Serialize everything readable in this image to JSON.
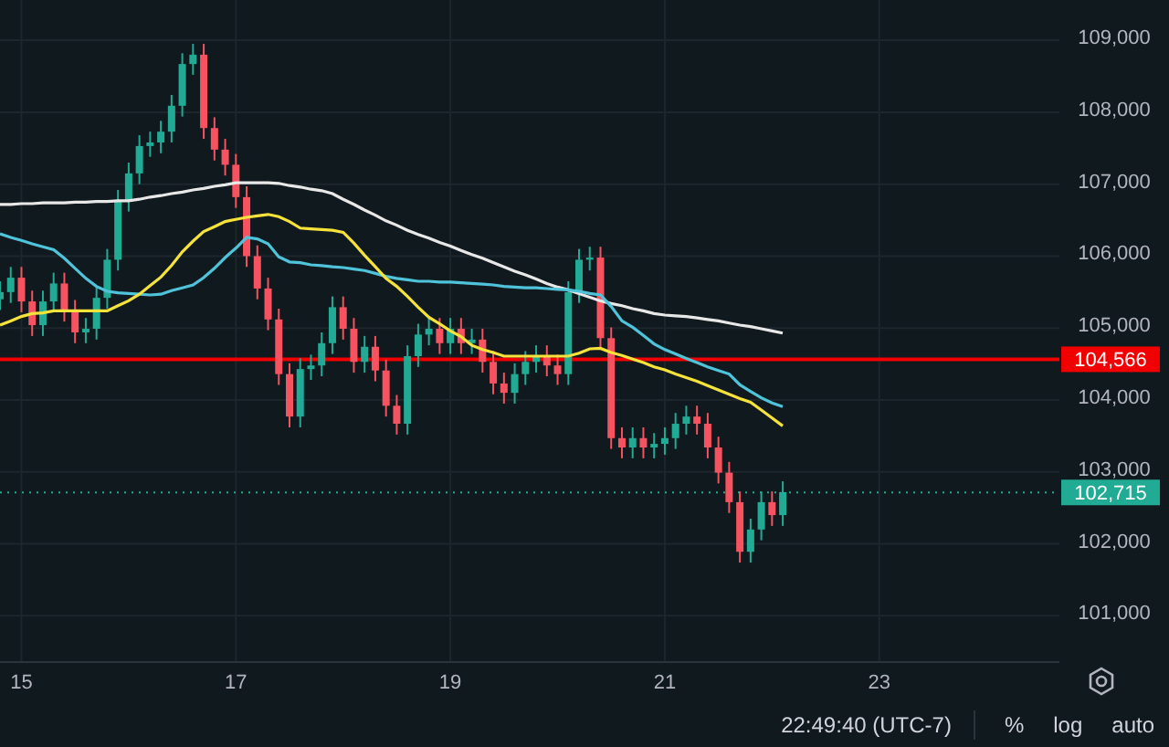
{
  "chart": {
    "chart_data": {
      "type": "candlestick",
      "x": [
        14.8,
        14.9,
        15.0,
        15.1,
        15.2,
        15.3,
        15.4,
        15.5,
        15.6,
        15.7,
        15.8,
        15.9,
        16.0,
        16.1,
        16.2,
        16.3,
        16.4,
        16.5,
        16.6,
        16.7,
        16.8,
        16.9,
        17.0,
        17.1,
        17.2,
        17.3,
        17.4,
        17.5,
        17.6,
        17.7,
        17.8,
        17.9,
        18.0,
        18.1,
        18.2,
        18.3,
        18.4,
        18.5,
        18.6,
        18.7,
        18.8,
        18.9,
        19.0,
        19.1,
        19.2,
        19.3,
        19.4,
        19.5,
        19.6,
        19.7,
        19.8,
        19.9,
        20.0,
        20.1,
        20.2,
        20.3,
        20.4,
        20.5,
        20.6,
        20.7,
        20.8,
        20.9,
        21.0,
        21.1,
        21.2,
        21.3,
        21.4,
        21.5,
        21.6,
        21.7,
        21.8,
        21.9,
        22.0,
        22.1
      ],
      "ohlc": [
        [
          105400,
          105650,
          105250,
          105500
        ],
        [
          105500,
          105850,
          105350,
          105700
        ],
        [
          105700,
          105850,
          105220,
          105370
        ],
        [
          105370,
          105520,
          104890,
          105040
        ],
        [
          105040,
          105520,
          104890,
          105370
        ],
        [
          105370,
          105770,
          105220,
          105620
        ],
        [
          105620,
          105770,
          105090,
          105240
        ],
        [
          105240,
          105390,
          104790,
          104940
        ],
        [
          104940,
          105140,
          104790,
          104990
        ],
        [
          104990,
          105570,
          104840,
          105420
        ],
        [
          105420,
          106100,
          105270,
          105950
        ],
        [
          105950,
          106920,
          105800,
          106770
        ],
        [
          106770,
          107300,
          106620,
          107150
        ],
        [
          107150,
          107680,
          107000,
          107530
        ],
        [
          107530,
          107730,
          107380,
          107580
        ],
        [
          107580,
          107880,
          107430,
          107730
        ],
        [
          107730,
          108240,
          107580,
          108090
        ],
        [
          108090,
          108820,
          107940,
          108670
        ],
        [
          108670,
          108950,
          108520,
          108800
        ],
        [
          108800,
          108950,
          107630,
          107780
        ],
        [
          107780,
          107930,
          107330,
          107480
        ],
        [
          107480,
          107630,
          107120,
          107270
        ],
        [
          107270,
          107420,
          106670,
          106820
        ],
        [
          106820,
          106970,
          105850,
          106000
        ],
        [
          106000,
          106150,
          105400,
          105550
        ],
        [
          105550,
          105700,
          104970,
          105120
        ],
        [
          105120,
          105270,
          104210,
          104360
        ],
        [
          104360,
          104510,
          103620,
          103770
        ],
        [
          103770,
          104580,
          103620,
          104430
        ],
        [
          104430,
          104630,
          104280,
          104480
        ],
        [
          104480,
          104940,
          104330,
          104790
        ],
        [
          104790,
          105440,
          104640,
          105290
        ],
        [
          105290,
          105440,
          104840,
          104990
        ],
        [
          104990,
          105140,
          104380,
          104530
        ],
        [
          104530,
          104890,
          104380,
          104740
        ],
        [
          104740,
          104890,
          104260,
          104410
        ],
        [
          104410,
          104560,
          103770,
          103920
        ],
        [
          103920,
          104070,
          103520,
          103670
        ],
        [
          103670,
          104760,
          103520,
          104610
        ],
        [
          104610,
          105060,
          104460,
          104910
        ],
        [
          104910,
          105140,
          104760,
          104990
        ],
        [
          104990,
          105140,
          104640,
          104790
        ],
        [
          104790,
          105140,
          104640,
          104990
        ],
        [
          104990,
          105140,
          104640,
          104790
        ],
        [
          104790,
          104990,
          104640,
          104840
        ],
        [
          104840,
          104990,
          104380,
          104530
        ],
        [
          104530,
          104680,
          104080,
          104230
        ],
        [
          104230,
          104380,
          103950,
          104100
        ],
        [
          104100,
          104510,
          103950,
          104360
        ],
        [
          104360,
          104680,
          104210,
          104530
        ],
        [
          104530,
          104760,
          104380,
          104610
        ],
        [
          104610,
          104760,
          104330,
          104480
        ],
        [
          104480,
          104630,
          104210,
          104360
        ],
        [
          104360,
          105650,
          104210,
          105500
        ],
        [
          105500,
          106100,
          105350,
          105950
        ],
        [
          105950,
          106130,
          105800,
          105980
        ],
        [
          105980,
          106130,
          104710,
          104860
        ],
        [
          104860,
          105010,
          103320,
          103470
        ],
        [
          103470,
          103620,
          103190,
          103340
        ],
        [
          103340,
          103620,
          103190,
          103470
        ],
        [
          103470,
          103620,
          103190,
          103340
        ],
        [
          103340,
          103540,
          103190,
          103390
        ],
        [
          103390,
          103620,
          103240,
          103470
        ],
        [
          103470,
          103820,
          103320,
          103670
        ],
        [
          103670,
          103920,
          103520,
          103770
        ],
        [
          103770,
          103920,
          103520,
          103670
        ],
        [
          103670,
          103820,
          103190,
          103340
        ],
        [
          103340,
          103490,
          102840,
          102990
        ],
        [
          102990,
          103140,
          102430,
          102580
        ],
        [
          102580,
          102730,
          101740,
          101890
        ],
        [
          101890,
          102350,
          101740,
          102200
        ],
        [
          102200,
          102730,
          102050,
          102580
        ],
        [
          102580,
          102730,
          102250,
          102400
        ],
        [
          102400,
          102870,
          102250,
          102720
        ]
      ],
      "series": [
        {
          "type": "line",
          "color": "#e8e8e8",
          "values": [
            106720,
            106720,
            106730,
            106730,
            106740,
            106740,
            106740,
            106750,
            106750,
            106760,
            106760,
            106770,
            106770,
            106790,
            106820,
            106840,
            106870,
            106890,
            106920,
            106940,
            106970,
            106990,
            107020,
            107020,
            107020,
            107020,
            107010,
            106980,
            106960,
            106930,
            106910,
            106870,
            106790,
            106720,
            106640,
            106570,
            106490,
            106430,
            106360,
            106300,
            106250,
            106190,
            106140,
            106080,
            106020,
            105970,
            105910,
            105850,
            105790,
            105740,
            105680,
            105620,
            105570,
            105530,
            105480,
            105430,
            105380,
            105340,
            105310,
            105270,
            105240,
            105200,
            105180,
            105170,
            105160,
            105140,
            105120,
            105100,
            105070,
            105040,
            105020,
            104990,
            104960,
            104930
          ]
        },
        {
          "type": "line",
          "color": "#4fc3d9",
          "values": [
            106310,
            106260,
            106220,
            106170,
            106130,
            106090,
            105970,
            105830,
            105690,
            105580,
            105510,
            105490,
            105480,
            105470,
            105460,
            105470,
            105520,
            105560,
            105600,
            105700,
            105830,
            105980,
            106110,
            106260,
            106240,
            106170,
            105990,
            105920,
            105910,
            105880,
            105870,
            105850,
            105840,
            105820,
            105800,
            105760,
            105720,
            105690,
            105670,
            105650,
            105650,
            105640,
            105640,
            105630,
            105620,
            105610,
            105600,
            105580,
            105570,
            105560,
            105560,
            105550,
            105540,
            105530,
            105510,
            105480,
            105460,
            105300,
            105100,
            105010,
            104900,
            104780,
            104700,
            104640,
            104580,
            104520,
            104460,
            104410,
            104360,
            104210,
            104120,
            104030,
            103960,
            103910
          ]
        },
        {
          "type": "line",
          "color": "#f5e23a",
          "values": [
            105040,
            105100,
            105160,
            105200,
            105210,
            105240,
            105240,
            105240,
            105240,
            105240,
            105240,
            105310,
            105380,
            105470,
            105590,
            105710,
            105870,
            106060,
            106210,
            106340,
            106410,
            106480,
            106510,
            106540,
            106560,
            106580,
            106550,
            106480,
            106390,
            106380,
            106370,
            106360,
            106330,
            106180,
            106010,
            105850,
            105690,
            105580,
            105440,
            105290,
            105150,
            105060,
            104960,
            104880,
            104760,
            104700,
            104660,
            104610,
            104610,
            104610,
            104610,
            104610,
            104610,
            104610,
            104650,
            104710,
            104720,
            104660,
            104620,
            104570,
            104520,
            104460,
            104420,
            104360,
            104310,
            104260,
            104200,
            104140,
            104080,
            104020,
            103970,
            103860,
            103750,
            103640
          ]
        }
      ],
      "xlim": [
        14.8,
        24.68
      ],
      "ylim": [
        100370,
        109560
      ],
      "xticks": [
        15,
        17,
        19,
        21,
        23
      ],
      "yticks": [
        {
          "value": 101000,
          "label": "101,000"
        },
        {
          "value": 102000,
          "label": "102,000"
        },
        {
          "value": 103000,
          "label": "103,000"
        },
        {
          "value": 104000,
          "label": "104,000"
        },
        {
          "value": 105000,
          "label": "105,000"
        },
        {
          "value": 106000,
          "label": "106,000"
        },
        {
          "value": 107000,
          "label": "107,000"
        },
        {
          "value": 108000,
          "label": "108,000"
        },
        {
          "value": 109000,
          "label": "109,000"
        }
      ],
      "grid": true,
      "ref_lines": [
        {
          "axis": "y",
          "value": 104566,
          "color": "#f20000"
        },
        {
          "axis": "y",
          "value": 102715,
          "color": "#22ab94",
          "line_style": "dotted"
        }
      ]
    },
    "price_labels": [
      "104,566",
      "102,715"
    ]
  },
  "status_bar": {
    "time": "22:49:40 (UTC-7)",
    "buttons": [
      "%",
      "log",
      "auto"
    ]
  }
}
